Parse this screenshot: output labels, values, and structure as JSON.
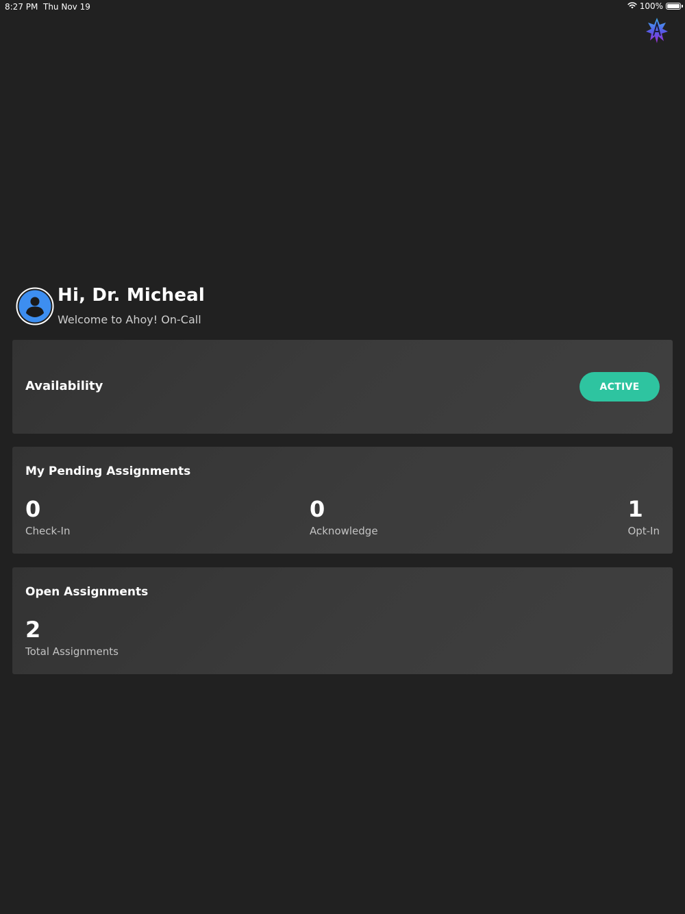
{
  "status_bar": {
    "time": "8:27 PM",
    "date": "Thu Nov 19",
    "battery_percent": "100%",
    "icons": [
      "wifi-icon",
      "battery-icon"
    ]
  },
  "header": {
    "logo": "ahoy-logo-icon"
  },
  "greeting": {
    "title": "Hi, Dr. Micheal",
    "subtitle": "Welcome to Ahoy! On-Call",
    "avatar_icon": "user-avatar-icon"
  },
  "availability": {
    "label": "Availability",
    "status_button": "ACTIVE",
    "status_color": "#2ec4a0"
  },
  "pending_assignments": {
    "title": "My Pending Assignments",
    "stats": [
      {
        "value": "0",
        "label": "Check-In"
      },
      {
        "value": "0",
        "label": "Acknowledge"
      },
      {
        "value": "1",
        "label": "Opt-In"
      }
    ]
  },
  "open_assignments": {
    "title": "Open Assignments",
    "total_value": "2",
    "total_label": "Total Assignments"
  },
  "colors": {
    "background": "#212121",
    "card": "#3a3a3a",
    "accent": "#2ec4a0",
    "avatar_blue": "#3d8ef0"
  }
}
